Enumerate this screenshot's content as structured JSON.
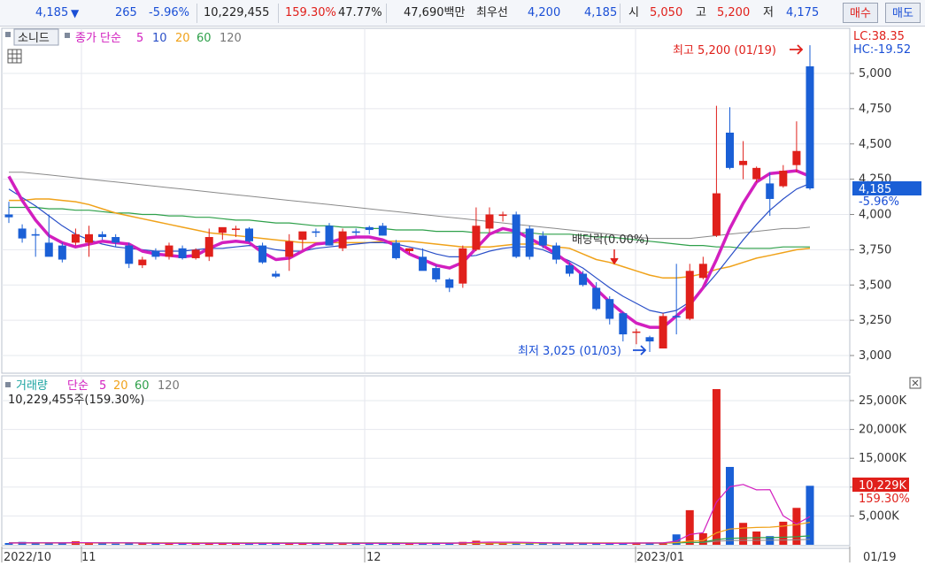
{
  "quote": {
    "price": "4,185",
    "arrow": "▼",
    "change": "265",
    "change_pct": "-5.96%",
    "volume": "10,229,455",
    "volume_ratio": "159.30%",
    "ratio2": "47.77%",
    "trade_value": "47,690백만",
    "best_quote_label": "최우선",
    "best_ask": "4,200",
    "best_bid": "4,185",
    "open_label": "시",
    "open": "5,050",
    "high_label": "고",
    "high": "5,200",
    "low_label": "저",
    "low": "4,175",
    "buy_button": "매수",
    "sell_button": "매도"
  },
  "price_pane": {
    "chart_type_button": "소니드",
    "legend_title": "종가 단순",
    "ma_labels": [
      "5",
      "10",
      "20",
      "60",
      "120"
    ],
    "lc_label": "LC:38.35",
    "hc_label": "HC:-19.52",
    "current_price_tag": "4,185",
    "current_pct_tag": "-5.96%",
    "high_annotation": "최고 5,200 (01/19)",
    "low_annotation": "최저 3,025 (01/03)",
    "dividend_annotation": "배당락(0.00%)"
  },
  "volume_pane": {
    "legend_title": "거래량",
    "legend_ma_title": "단순",
    "ma_labels": [
      "5",
      "20",
      "60",
      "120"
    ],
    "subtitle": "10,229,455주(159.30%)",
    "current_volume_tag": "10,229K",
    "current_pct_tag": "159.30%"
  },
  "x_axis": {
    "labels": [
      "2022/10",
      "11",
      "12",
      "2023/01",
      "01/19"
    ]
  },
  "colors": {
    "up": "#e0201b",
    "down": "#1a5fd6",
    "ma5": "#d21fbf",
    "ma10": "#2a4fc8",
    "ma20": "#f0a21a",
    "ma60": "#2ea04a",
    "ma120": "#8a8a8a"
  },
  "chart_data": [
    {
      "type": "candlestick",
      "y_axis_ticks": [
        3000,
        3250,
        3500,
        3750,
        4000,
        4250,
        4500,
        4750,
        5000
      ],
      "ylim": [
        2800,
        5300
      ],
      "grid": true,
      "legend_placement": "top-left",
      "candles": [
        {
          "o": 4000,
          "h": 4090,
          "l": 3940,
          "c": 3980
        },
        {
          "o": 3900,
          "h": 3930,
          "l": 3800,
          "c": 3830
        },
        {
          "o": 3860,
          "h": 3900,
          "l": 3700,
          "c": 3850
        },
        {
          "o": 3800,
          "h": 4000,
          "l": 3780,
          "c": 3700
        },
        {
          "o": 3780,
          "h": 3800,
          "l": 3660,
          "c": 3680
        },
        {
          "o": 3800,
          "h": 3900,
          "l": 3780,
          "c": 3860
        },
        {
          "o": 3800,
          "h": 3920,
          "l": 3700,
          "c": 3860
        },
        {
          "o": 3860,
          "h": 3880,
          "l": 3820,
          "c": 3840
        },
        {
          "o": 3840,
          "h": 3860,
          "l": 3770,
          "c": 3800
        },
        {
          "o": 3780,
          "h": 3800,
          "l": 3620,
          "c": 3650
        },
        {
          "o": 3640,
          "h": 3700,
          "l": 3620,
          "c": 3680
        },
        {
          "o": 3740,
          "h": 3760,
          "l": 3680,
          "c": 3700
        },
        {
          "o": 3700,
          "h": 3800,
          "l": 3680,
          "c": 3780
        },
        {
          "o": 3760,
          "h": 3780,
          "l": 3680,
          "c": 3690
        },
        {
          "o": 3690,
          "h": 3760,
          "l": 3680,
          "c": 3750
        },
        {
          "o": 3700,
          "h": 3900,
          "l": 3670,
          "c": 3840
        },
        {
          "o": 3870,
          "h": 3900,
          "l": 3820,
          "c": 3910
        },
        {
          "o": 3890,
          "h": 3920,
          "l": 3840,
          "c": 3900
        },
        {
          "o": 3900,
          "h": 3910,
          "l": 3800,
          "c": 3810
        },
        {
          "o": 3780,
          "h": 3800,
          "l": 3650,
          "c": 3660
        },
        {
          "o": 3580,
          "h": 3600,
          "l": 3550,
          "c": 3560
        },
        {
          "o": 3700,
          "h": 3860,
          "l": 3600,
          "c": 3810
        },
        {
          "o": 3820,
          "h": 3840,
          "l": 3750,
          "c": 3880
        },
        {
          "o": 3880,
          "h": 3900,
          "l": 3840,
          "c": 3870
        },
        {
          "o": 3920,
          "h": 3940,
          "l": 3780,
          "c": 3780
        },
        {
          "o": 3760,
          "h": 3900,
          "l": 3740,
          "c": 3880
        },
        {
          "o": 3880,
          "h": 3900,
          "l": 3850,
          "c": 3870
        },
        {
          "o": 3910,
          "h": 3920,
          "l": 3860,
          "c": 3890
        },
        {
          "o": 3920,
          "h": 3940,
          "l": 3850,
          "c": 3850
        },
        {
          "o": 3800,
          "h": 3820,
          "l": 3680,
          "c": 3690
        },
        {
          "o": 3740,
          "h": 3760,
          "l": 3720,
          "c": 3760
        },
        {
          "o": 3700,
          "h": 3760,
          "l": 3620,
          "c": 3600
        },
        {
          "o": 3620,
          "h": 3640,
          "l": 3520,
          "c": 3540
        },
        {
          "o": 3540,
          "h": 3550,
          "l": 3450,
          "c": 3480
        },
        {
          "o": 3510,
          "h": 3780,
          "l": 3480,
          "c": 3760
        },
        {
          "o": 3750,
          "h": 4050,
          "l": 3740,
          "c": 3920
        },
        {
          "o": 3900,
          "h": 4050,
          "l": 3870,
          "c": 4000
        },
        {
          "o": 3990,
          "h": 4020,
          "l": 3950,
          "c": 4000
        },
        {
          "o": 4000,
          "h": 4020,
          "l": 3690,
          "c": 3700
        },
        {
          "o": 3900,
          "h": 3920,
          "l": 3680,
          "c": 3700
        },
        {
          "o": 3850,
          "h": 3880,
          "l": 3760,
          "c": 3780
        },
        {
          "o": 3780,
          "h": 3800,
          "l": 3650,
          "c": 3680
        },
        {
          "o": 3640,
          "h": 3660,
          "l": 3560,
          "c": 3580
        },
        {
          "o": 3580,
          "h": 3600,
          "l": 3490,
          "c": 3500
        },
        {
          "o": 3480,
          "h": 3520,
          "l": 3320,
          "c": 3330
        },
        {
          "o": 3400,
          "h": 3420,
          "l": 3220,
          "c": 3260
        },
        {
          "o": 3300,
          "h": 3310,
          "l": 3100,
          "c": 3150
        },
        {
          "o": 3170,
          "h": 3190,
          "l": 3080,
          "c": 3170
        },
        {
          "o": 3130,
          "h": 3140,
          "l": 3025,
          "c": 3100
        },
        {
          "o": 3050,
          "h": 3300,
          "l": 3050,
          "c": 3280
        },
        {
          "o": 3280,
          "h": 3650,
          "l": 3150,
          "c": 3270
        },
        {
          "o": 3260,
          "h": 3650,
          "l": 3250,
          "c": 3600
        },
        {
          "o": 3550,
          "h": 3700,
          "l": 3540,
          "c": 3650
        },
        {
          "o": 3850,
          "h": 4770,
          "l": 3840,
          "c": 4150
        },
        {
          "o": 4580,
          "h": 4760,
          "l": 4320,
          "c": 4330
        },
        {
          "o": 4350,
          "h": 4520,
          "l": 4250,
          "c": 4380
        },
        {
          "o": 4250,
          "h": 4340,
          "l": 4230,
          "c": 4330
        },
        {
          "o": 4220,
          "h": 4300,
          "l": 3990,
          "c": 4110
        },
        {
          "o": 4200,
          "h": 4350,
          "l": 4190,
          "c": 4310
        },
        {
          "o": 4350,
          "h": 4660,
          "l": 4300,
          "c": 4450
        },
        {
          "o": 5050,
          "h": 5200,
          "l": 4175,
          "c": 4185
        }
      ],
      "ma5": [
        4270,
        4100,
        3960,
        3850,
        3800,
        3770,
        3790,
        3810,
        3800,
        3790,
        3740,
        3720,
        3710,
        3700,
        3710,
        3760,
        3800,
        3810,
        3800,
        3730,
        3680,
        3690,
        3740,
        3790,
        3800,
        3830,
        3840,
        3840,
        3820,
        3780,
        3720,
        3680,
        3640,
        3620,
        3660,
        3760,
        3860,
        3900,
        3880,
        3830,
        3780,
        3720,
        3650,
        3570,
        3470,
        3380,
        3300,
        3230,
        3200,
        3200,
        3280,
        3360,
        3480,
        3680,
        3900,
        4080,
        4230,
        4290,
        4300,
        4310,
        4270
      ],
      "ma10": [
        4180,
        4120,
        4060,
        3990,
        3920,
        3860,
        3820,
        3790,
        3770,
        3760,
        3750,
        3740,
        3740,
        3740,
        3750,
        3760,
        3760,
        3770,
        3780,
        3770,
        3750,
        3740,
        3740,
        3760,
        3770,
        3780,
        3790,
        3800,
        3800,
        3790,
        3770,
        3750,
        3720,
        3700,
        3700,
        3710,
        3740,
        3760,
        3770,
        3770,
        3750,
        3710,
        3670,
        3620,
        3550,
        3480,
        3420,
        3370,
        3320,
        3300,
        3320,
        3380,
        3470,
        3580,
        3700,
        3820,
        3930,
        4030,
        4110,
        4180,
        4220
      ],
      "ma20": [
        4100,
        4100,
        4110,
        4110,
        4100,
        4090,
        4070,
        4040,
        4010,
        3990,
        3970,
        3950,
        3930,
        3910,
        3890,
        3870,
        3860,
        3850,
        3840,
        3830,
        3820,
        3810,
        3800,
        3800,
        3800,
        3800,
        3800,
        3800,
        3810,
        3810,
        3810,
        3800,
        3790,
        3780,
        3770,
        3770,
        3770,
        3780,
        3790,
        3790,
        3790,
        3770,
        3760,
        3720,
        3680,
        3660,
        3630,
        3600,
        3570,
        3550,
        3550,
        3560,
        3580,
        3610,
        3630,
        3660,
        3690,
        3710,
        3730,
        3750,
        3760
      ],
      "ma60": [
        4050,
        4050,
        4050,
        4040,
        4040,
        4030,
        4030,
        4020,
        4010,
        4010,
        4000,
        4000,
        3990,
        3990,
        3980,
        3980,
        3970,
        3960,
        3960,
        3950,
        3940,
        3940,
        3930,
        3920,
        3920,
        3910,
        3910,
        3900,
        3900,
        3890,
        3890,
        3890,
        3880,
        3880,
        3880,
        3870,
        3870,
        3870,
        3870,
        3870,
        3860,
        3860,
        3860,
        3850,
        3840,
        3840,
        3830,
        3820,
        3810,
        3800,
        3790,
        3780,
        3780,
        3770,
        3770,
        3760,
        3760,
        3760,
        3770,
        3770,
        3770
      ],
      "ma120": [
        4300,
        4300,
        4290,
        4280,
        4270,
        4260,
        4250,
        4240,
        4230,
        4220,
        4210,
        4200,
        4190,
        4180,
        4170,
        4160,
        4150,
        4140,
        4130,
        4120,
        4110,
        4100,
        4090,
        4080,
        4070,
        4060,
        4050,
        4040,
        4030,
        4020,
        4010,
        4000,
        3990,
        3980,
        3970,
        3960,
        3950,
        3940,
        3930,
        3920,
        3910,
        3900,
        3890,
        3880,
        3870,
        3860,
        3850,
        3840,
        3830,
        3830,
        3830,
        3830,
        3840,
        3850,
        3860,
        3870,
        3880,
        3890,
        3900,
        3900,
        3910
      ]
    },
    {
      "type": "bar",
      "y_axis_ticks": [
        "5,000K",
        "10,000K",
        "15,000K",
        "20,000K",
        "25,000K"
      ],
      "ylim": [
        0,
        28000
      ],
      "grid": true,
      "volume_k": [
        300,
        500,
        300,
        250,
        250,
        600,
        300,
        250,
        200,
        350,
        250,
        200,
        200,
        250,
        250,
        300,
        250,
        200,
        200,
        250,
        300,
        300,
        200,
        250,
        300,
        300,
        200,
        200,
        250,
        200,
        250,
        250,
        300,
        250,
        500,
        700,
        400,
        300,
        350,
        350,
        250,
        200,
        250,
        250,
        300,
        250,
        250,
        400,
        300,
        400,
        1800,
        6000,
        2000,
        27000,
        13500,
        3800,
        2300,
        1500,
        4000,
        6400,
        10229
      ],
      "ma5_k": [
        300,
        320,
        330,
        340,
        320,
        370,
        360,
        340,
        330,
        340,
        290,
        260,
        250,
        250,
        230,
        240,
        250,
        240,
        230,
        240,
        250,
        250,
        240,
        250,
        260,
        270,
        260,
        240,
        250,
        230,
        230,
        230,
        250,
        250,
        320,
        420,
        460,
        450,
        450,
        420,
        360,
        310,
        290,
        280,
        260,
        250,
        250,
        290,
        300,
        320,
        630,
        1780,
        2100,
        7400,
        10060,
        10460,
        9520,
        9560,
        5020,
        3600,
        4886
      ],
      "ma20_k": [
        300,
        300,
        300,
        300,
        300,
        310,
        310,
        310,
        310,
        310,
        310,
        300,
        300,
        290,
        290,
        290,
        280,
        280,
        280,
        270,
        270,
        260,
        260,
        260,
        260,
        260,
        260,
        260,
        260,
        260,
        260,
        260,
        260,
        260,
        270,
        290,
        300,
        300,
        310,
        310,
        310,
        310,
        310,
        310,
        300,
        300,
        290,
        300,
        300,
        310,
        380,
        650,
        740,
        2070,
        2730,
        2900,
        3000,
        3050,
        3240,
        3500,
        3900
      ],
      "ma60_k": [
        320,
        320,
        320,
        320,
        320,
        320,
        320,
        320,
        320,
        320,
        310,
        310,
        310,
        310,
        310,
        300,
        300,
        300,
        300,
        300,
        300,
        300,
        300,
        300,
        300,
        300,
        300,
        300,
        300,
        300,
        290,
        290,
        290,
        290,
        290,
        290,
        290,
        290,
        290,
        290,
        290,
        290,
        290,
        290,
        290,
        290,
        290,
        290,
        290,
        290,
        320,
        420,
        450,
        900,
        1120,
        1180,
        1220,
        1240,
        1300,
        1400,
        1550
      ],
      "ma120_k": [
        350,
        350,
        350,
        350,
        350,
        350,
        350,
        350,
        350,
        350,
        350,
        350,
        350,
        350,
        350,
        350,
        350,
        350,
        350,
        340,
        340,
        340,
        340,
        340,
        340,
        340,
        340,
        340,
        340,
        340,
        330,
        330,
        330,
        330,
        330,
        330,
        330,
        330,
        330,
        330,
        330,
        330,
        330,
        330,
        330,
        330,
        330,
        330,
        330,
        330,
        340,
        390,
        400,
        620,
        730,
        760,
        770,
        780,
        810,
        860,
        940
      ]
    }
  ]
}
